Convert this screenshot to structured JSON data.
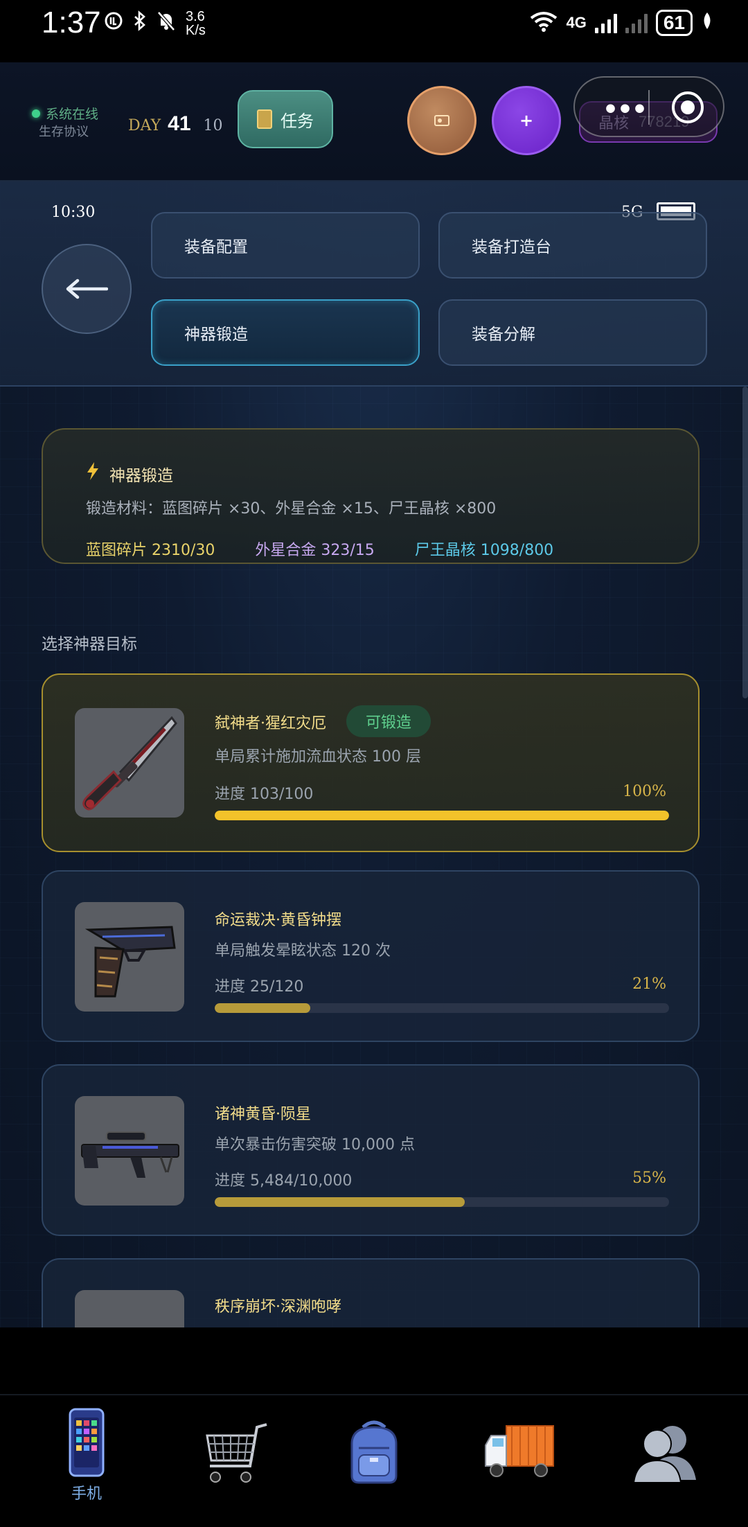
{
  "status_bar": {
    "time": "1:37",
    "speed_value": "3.6",
    "speed_unit": "K/s",
    "network": "4G",
    "battery": "61"
  },
  "header": {
    "online_text": "系统在线",
    "protocol_text": "生存协议",
    "day_label": "DAY",
    "day_number": "41",
    "day_sub": "10",
    "task_label": "任务",
    "crystal_label": "晶核",
    "crystal_value": "778219"
  },
  "inner_status": {
    "time": "10:30",
    "network": "5G"
  },
  "nav": {
    "buttons": [
      {
        "label": "装备配置"
      },
      {
        "label": "装备打造台"
      },
      {
        "label": "神器锻造"
      },
      {
        "label": "装备分解"
      }
    ],
    "active": "神器锻造"
  },
  "forge": {
    "title": "神器锻造",
    "materials": "锻造材料：蓝图碎片 ×30、外星合金 ×15、尸王晶核 ×800",
    "stats": [
      {
        "text": "蓝图碎片 2310/30",
        "color": "#e9d36a"
      },
      {
        "text": "外星合金 323/15",
        "color": "#c7a8f0"
      },
      {
        "text": "尸王晶核 1098/800",
        "color": "#5cc9e8"
      }
    ]
  },
  "section_label": "选择神器目标",
  "targets": [
    {
      "name": "弑神者·猩红灾厄",
      "badge": "可锻造",
      "desc": "单局累计施加流血状态 100 层",
      "progress": "进度 103/100",
      "percent": "100%",
      "fill": 1.0,
      "icon": "dagger-icon"
    },
    {
      "name": "命运裁决·黄昏钟摆",
      "desc": "单局触发晕眩状态 120 次",
      "progress": "进度 25/120",
      "percent": "21%",
      "fill": 0.21,
      "icon": "pistol-icon"
    },
    {
      "name": "诸神黄昏·陨星",
      "desc": "单次暴击伤害突破 10,000 点",
      "progress": "进度 5,484/10,000",
      "percent": "55%",
      "fill": 0.55,
      "icon": "sniper-rifle-icon"
    },
    {
      "name": "秩序崩坏·深渊咆哮",
      "desc": "",
      "icon": "weapon-icon"
    }
  ],
  "bottom_nav": {
    "items": [
      {
        "label": "手机",
        "icon": "phone-icon"
      },
      {
        "label": "",
        "icon": "cart-icon"
      },
      {
        "label": "",
        "icon": "backpack-icon"
      },
      {
        "label": "",
        "icon": "truck-icon"
      },
      {
        "label": "",
        "icon": "contacts-icon"
      }
    ]
  }
}
